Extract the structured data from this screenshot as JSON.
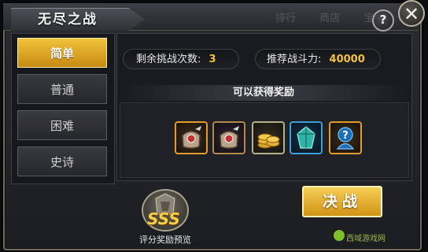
{
  "window": {
    "title": "无尽之战",
    "faint_tabs": [
      "排行",
      "商店",
      "宝箱"
    ],
    "help_label": "?",
    "close_label": "✕"
  },
  "difficulties": [
    {
      "label": "简单",
      "selected": true
    },
    {
      "label": "普通",
      "selected": false
    },
    {
      "label": "困难",
      "selected": false
    },
    {
      "label": "史诗",
      "selected": false
    }
  ],
  "stats": {
    "attempts_label": "剩余挑战次数:",
    "attempts_value": "3",
    "power_label": "推荐战斗力:",
    "power_value": "40000"
  },
  "rewards": {
    "header": "可以获得奖励",
    "items": [
      {
        "icon": "equipment-bag-icon",
        "rarity": "orange"
      },
      {
        "icon": "equipment-bag-icon",
        "rarity": "purple"
      },
      {
        "icon": "gold-coins-icon",
        "rarity": "gold"
      },
      {
        "icon": "teal-crystal-icon",
        "rarity": "blue"
      },
      {
        "icon": "mystery-hero-icon",
        "rarity": "orange"
      }
    ]
  },
  "grade_badge": {
    "grade": "SSS",
    "label": "评分奖励预览"
  },
  "fight_button": "决战",
  "watermark": "西域游戏网",
  "colors": {
    "accent_gold": "#f1c23b",
    "button_gold": "#e0a828",
    "rarity_orange": "#e39b2a",
    "rarity_blue": "#3aa0d8"
  }
}
